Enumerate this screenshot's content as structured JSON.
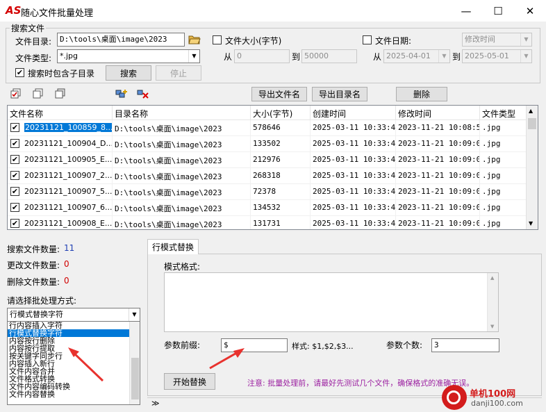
{
  "window": {
    "logo_text": "AS",
    "title": "随心文件批量处理",
    "minimize_glyph": "—",
    "maximize_glyph": "☐",
    "close_glyph": "✕"
  },
  "search": {
    "group_title": "搜索文件",
    "dir_label": "文件目录:",
    "dir_value": "D:\\tools\\桌面\\image\\2023",
    "type_label": "文件类型:",
    "type_value": "*.jpg",
    "include_sub_label": "搜索时包含子目录",
    "include_sub_checked": true,
    "search_button": "搜索",
    "stop_button": "停止",
    "size_filter_label": "文件大小(字节)",
    "size_filter_checked": false,
    "from_label": "从",
    "to_label": "到",
    "size_from": "0",
    "size_to": "50000",
    "date_filter_label": "文件日期:",
    "date_filter_checked": false,
    "date_type_value": "修改时间",
    "date_from_label": "从",
    "date_to_label": "到",
    "date_from": "2025-04-01",
    "date_to": "2025-05-01"
  },
  "toolbar": {
    "icons": [
      "check-all-icon",
      "uncheck-all-icon",
      "invert-select-icon",
      "add-files-icon",
      "remove-files-icon"
    ],
    "export_files_button": "导出文件名",
    "export_dirs_button": "导出目录名",
    "delete_button": "删除"
  },
  "table": {
    "columns": [
      "文件名称",
      "目录名称",
      "大小(字节)",
      "创建时间",
      "修改时间",
      "文件类型"
    ],
    "rows": [
      {
        "name": "20231121_100859_8...",
        "dir": "D:\\tools\\桌面\\image\\2023",
        "size": "578646",
        "created": "2025-03-11 10:33:44",
        "modified": "2023-11-21 10:08:59",
        "type": ".jpg",
        "checked": true,
        "selected": true
      },
      {
        "name": "20231121_100904_D...",
        "dir": "D:\\tools\\桌面\\image\\2023",
        "size": "133502",
        "created": "2025-03-11 10:33:44",
        "modified": "2023-11-21 10:09:04",
        "type": ".jpg",
        "checked": true,
        "selected": false
      },
      {
        "name": "20231121_100905_E...",
        "dir": "D:\\tools\\桌面\\image\\2023",
        "size": "212976",
        "created": "2025-03-11 10:33:44",
        "modified": "2023-11-21 10:09:05",
        "type": ".jpg",
        "checked": true,
        "selected": false
      },
      {
        "name": "20231121_100907_2...",
        "dir": "D:\\tools\\桌面\\image\\2023",
        "size": "268318",
        "created": "2025-03-11 10:33:44",
        "modified": "2023-11-21 10:09:07",
        "type": ".jpg",
        "checked": true,
        "selected": false
      },
      {
        "name": "20231121_100907_5...",
        "dir": "D:\\tools\\桌面\\image\\2023",
        "size": "72378",
        "created": "2025-03-11 10:33:44",
        "modified": "2023-11-21 10:09:07",
        "type": ".jpg",
        "checked": true,
        "selected": false
      },
      {
        "name": "20231121_100907_6...",
        "dir": "D:\\tools\\桌面\\image\\2023",
        "size": "134532",
        "created": "2025-03-11 10:33:44",
        "modified": "2023-11-21 10:09:07",
        "type": ".jpg",
        "checked": true,
        "selected": false
      },
      {
        "name": "20231121_100908_E...",
        "dir": "D:\\tools\\桌面\\image\\2023",
        "size": "131731",
        "created": "2025-03-11 10:33:44",
        "modified": "2023-11-21 10:09:08",
        "type": ".jpg",
        "checked": true,
        "selected": false
      }
    ]
  },
  "stats": {
    "searched_label": "搜索文件数量:",
    "searched_value": "11",
    "changed_label": "更改文件数量:",
    "changed_value": "0",
    "deleted_label": "删除文件数量:",
    "deleted_value": "0"
  },
  "mode": {
    "label": "请选择批处理方式:",
    "selected": "行模式替换字符",
    "options": [
      "行内容插入字符",
      "行模式替换字符",
      "内容按行删除",
      "内容按行提取",
      "按关键字同步行",
      "内容插入新行",
      "文件内容合并",
      "文件格式转换",
      "文件内容编码转换",
      "文件内容替换"
    ],
    "selected_index": 1
  },
  "panel": {
    "tab_label": "行模式替换",
    "pattern_label": "模式格式:",
    "pattern_value": "",
    "param_prefix_label": "参数前缀:",
    "param_prefix_value": "$",
    "style_text": "样式: $1,$2,$3...",
    "param_count_label": "参数个数:",
    "param_count_value": "3",
    "start_button": "开始替换",
    "notice": "注意: 批量处理前，请最好先测试几个文件，确保格式的准确无误。",
    "expand_glyph": "≫"
  },
  "watermark": {
    "site_name": "单机100网",
    "site_url": "danji100.com"
  },
  "colors": {
    "accent": "#0078d7",
    "notice": "#9b1fa0",
    "stat_blue": "#1f3fb3",
    "stat_red": "#d00000",
    "arrow_red": "#e8322e"
  }
}
